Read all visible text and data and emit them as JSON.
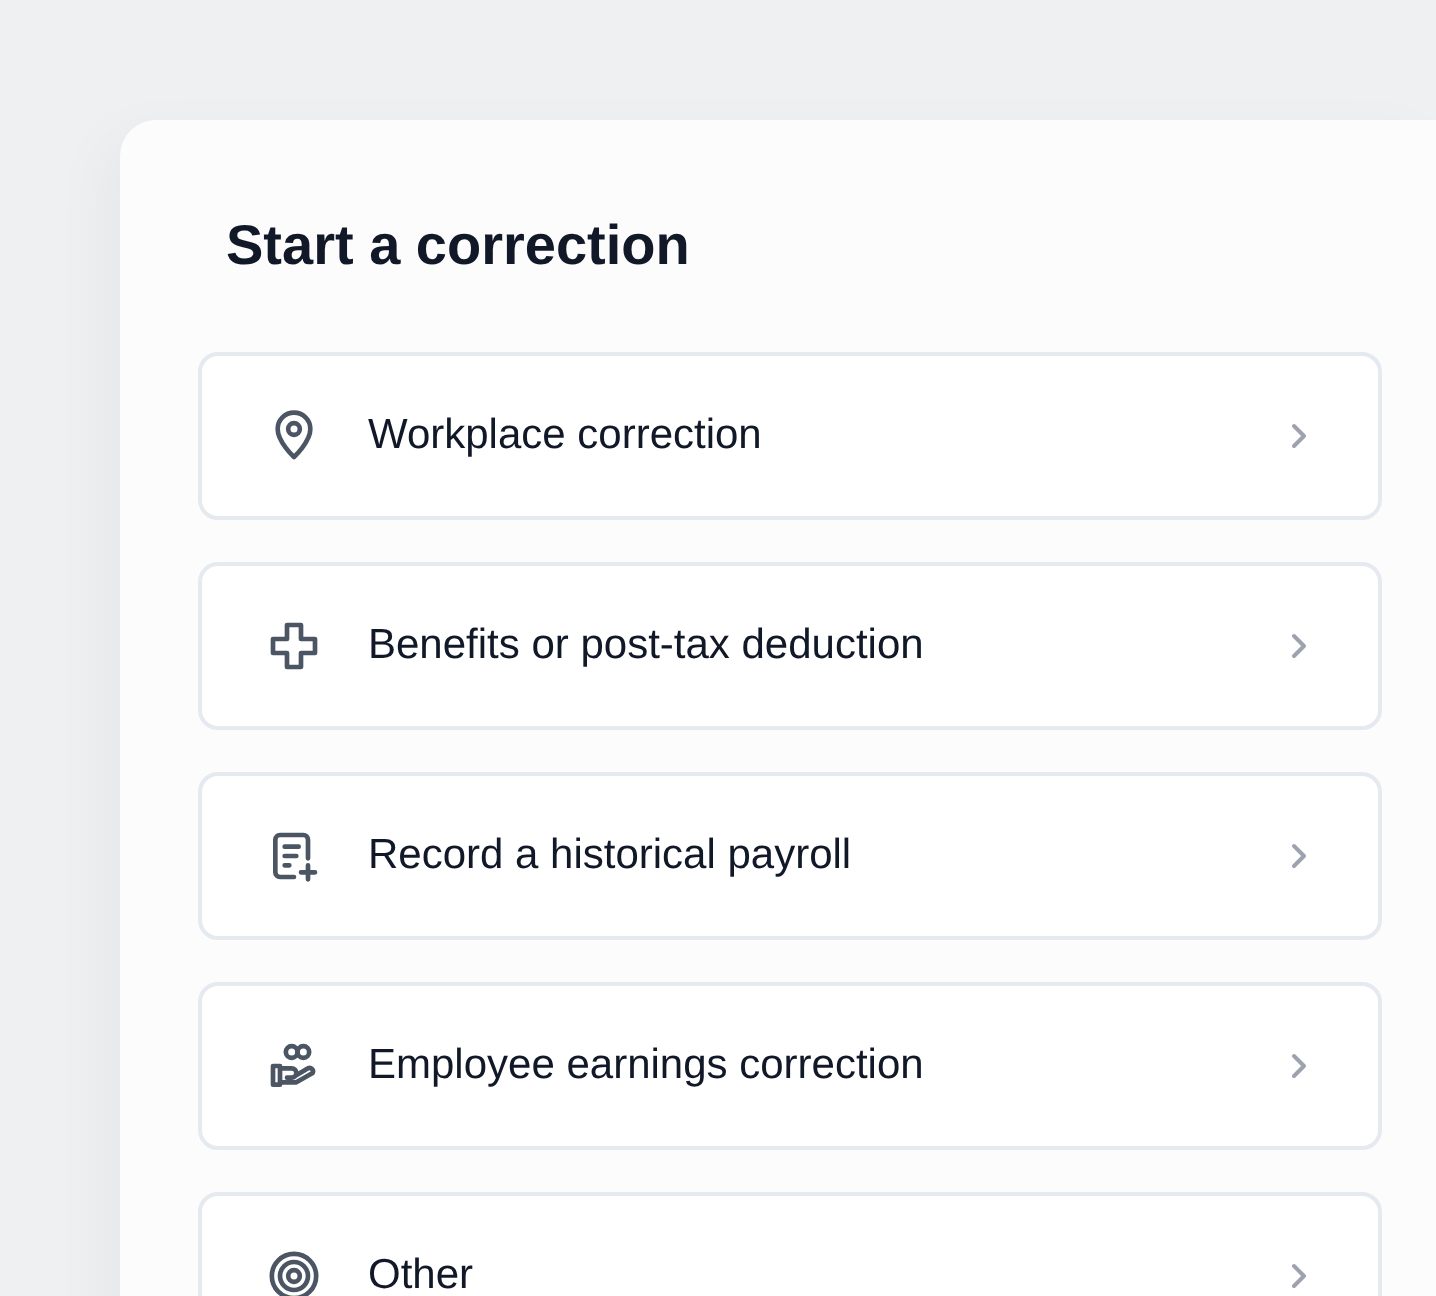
{
  "title": "Start a correction",
  "options": [
    {
      "label": "Workplace correction"
    },
    {
      "label": "Benefits or post-tax deduction"
    },
    {
      "label": "Record a historical payroll"
    },
    {
      "label": "Employee earnings correction"
    },
    {
      "label": "Other"
    }
  ]
}
